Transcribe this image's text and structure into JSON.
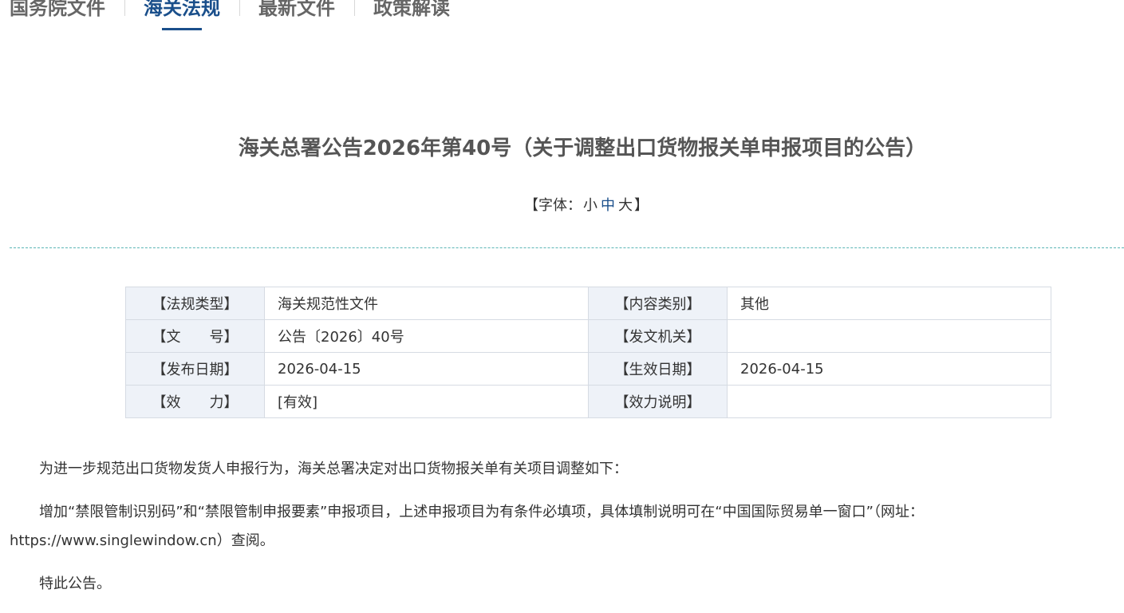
{
  "nav": {
    "tabs": [
      {
        "label": "国务院文件",
        "active": false
      },
      {
        "label": "海关法规",
        "active": true
      },
      {
        "label": "最新文件",
        "active": false
      },
      {
        "label": "政策解读",
        "active": false
      }
    ]
  },
  "article": {
    "title": "海关总署公告2026年第40号（关于调整出口货物报关单申报项目的公告）",
    "font_size": {
      "prefix": "【字体：",
      "small": "小",
      "medium": "中",
      "large": "大",
      "suffix": "】"
    },
    "meta": {
      "regulation_type_label": "【法规类型】",
      "regulation_type_value": "海关规范性文件",
      "content_category_label": "【内容类别】",
      "content_category_value": "其他",
      "doc_number_label": "【文　　号】",
      "doc_number_value": "公告〔2026〕40号",
      "issuing_authority_label": "【发文机关】",
      "issuing_authority_value": "",
      "publish_date_label": "【发布日期】",
      "publish_date_value": "2026-04-15",
      "effective_date_label": "【生效日期】",
      "effective_date_value": "2026-04-15",
      "validity_label": "【效　　力】",
      "validity_value": "[有效]",
      "validity_note_label": "【效力说明】",
      "validity_note_value": ""
    },
    "paragraphs": [
      "为进一步规范出口货物发货人申报行为，海关总署决定对出口货物报关单有关项目调整如下：",
      "增加“禁限管制识别码”和“禁限管制申报要素”申报项目，上述申报项目为有条件必填项，具体填制说明可在“中国国际贸易单一窗口”（网址：https://www.singlewindow.cn）查阅。",
      "特此公告。"
    ]
  },
  "colors": {
    "accent": "#1a4f8b",
    "divider": "#5bb5b5",
    "label_bg": "#eef2f8",
    "border": "#d6dbe3"
  }
}
